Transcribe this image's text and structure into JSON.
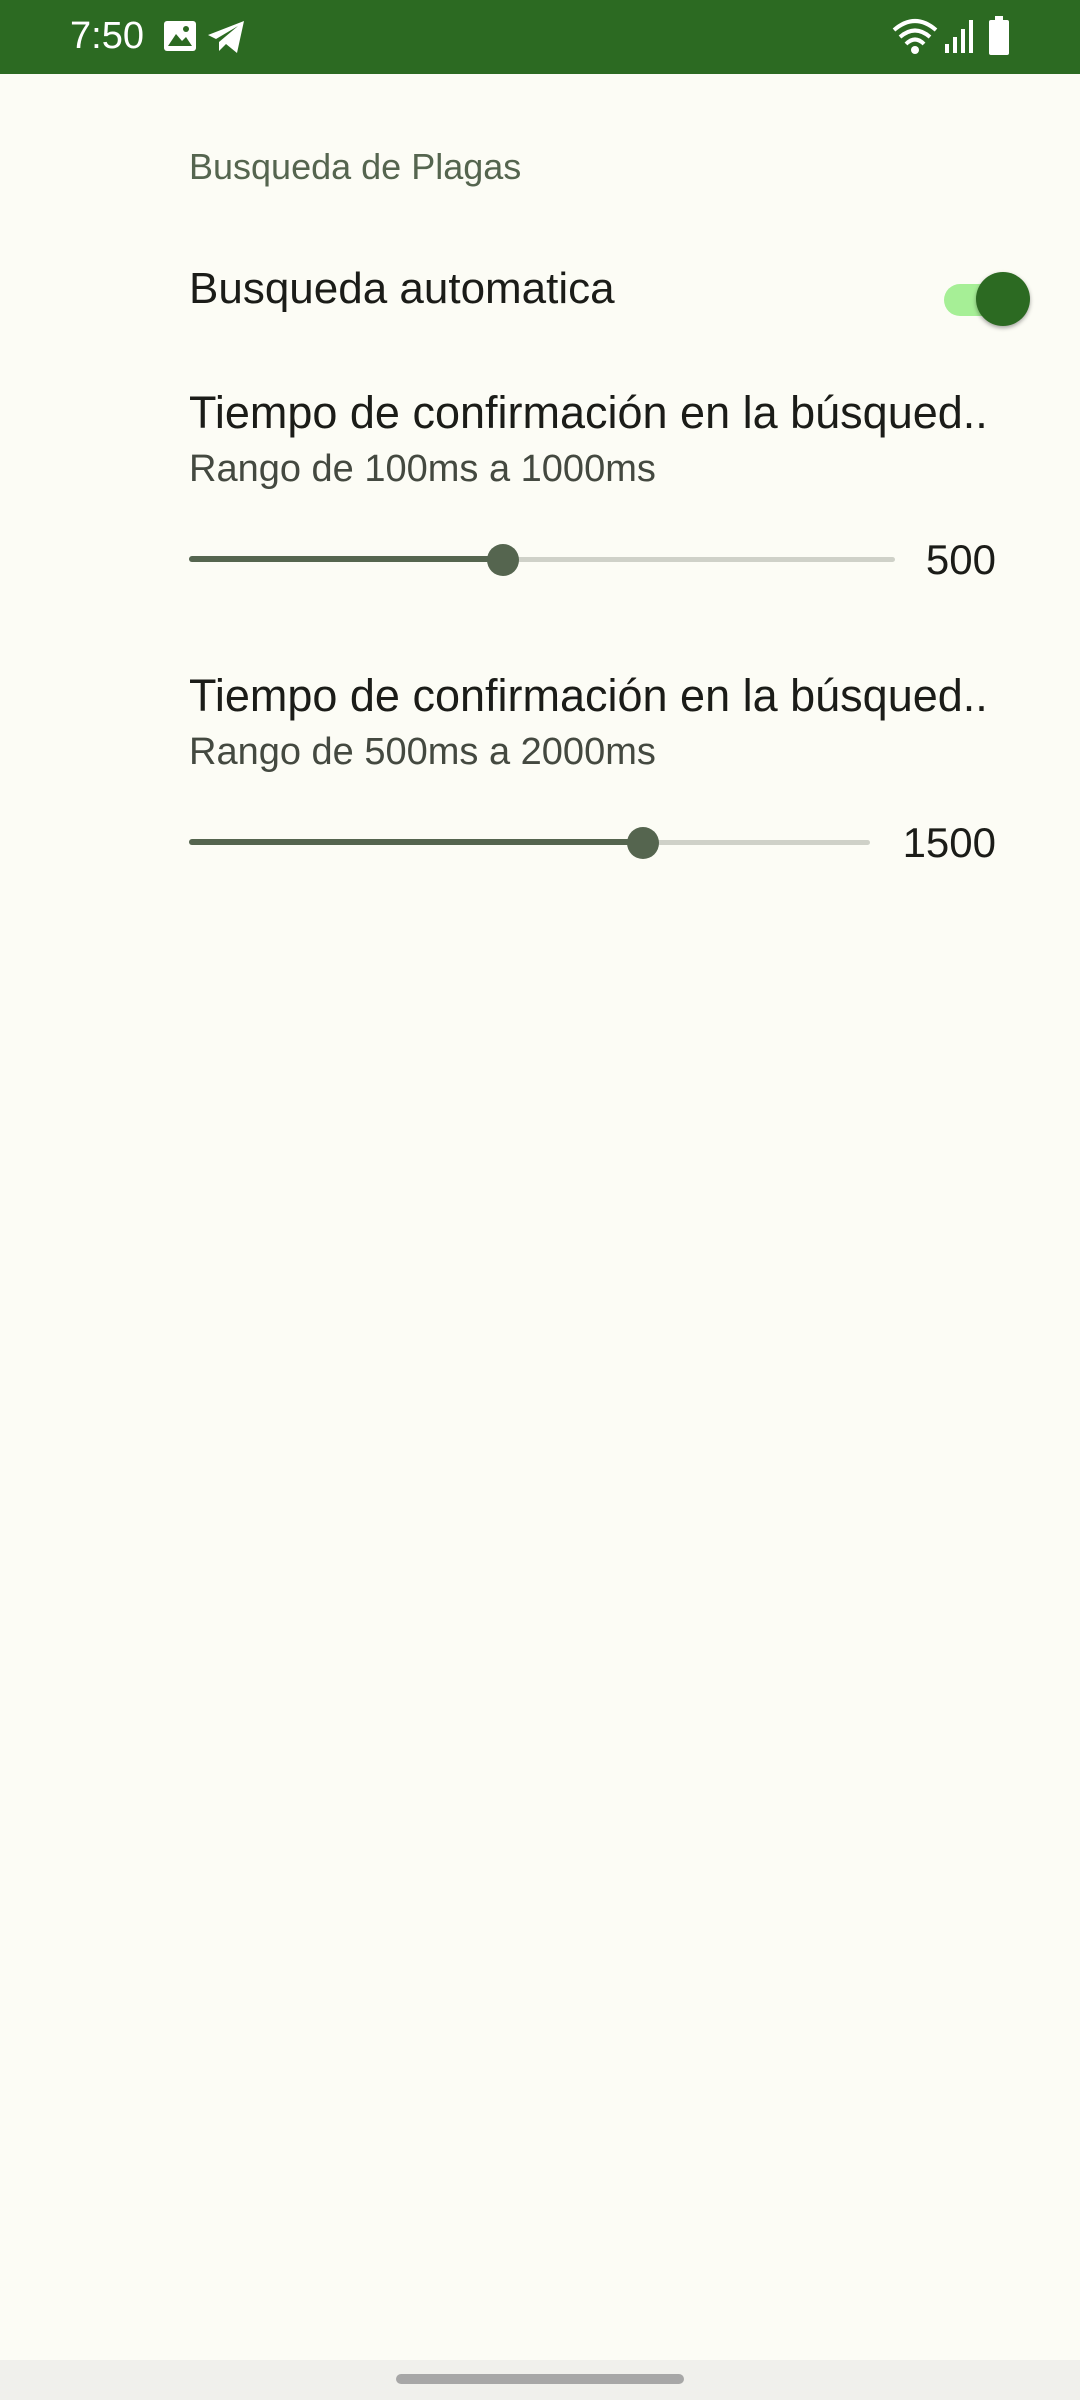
{
  "status_bar": {
    "time": "7:50",
    "left_icons": [
      "image-icon",
      "telegram-icon"
    ],
    "right_icons": [
      "wifi-icon",
      "signal-icon",
      "battery-icon"
    ],
    "color": "#2c6a22"
  },
  "section": {
    "title": "Busqueda de Plagas"
  },
  "auto_search": {
    "label": "Busqueda automatica",
    "enabled": true
  },
  "preferences": [
    {
      "title": "Tiempo de confirmación en la búsqued..",
      "summary": "Rango de 100ms a 1000ms",
      "min": 100,
      "max": 1000,
      "value": 500,
      "value_label": "500"
    },
    {
      "title": "Tiempo de confirmación en la búsqued..",
      "summary": "Rango de 500ms a 2000ms",
      "min": 500,
      "max": 2000,
      "value": 1500,
      "value_label": "1500"
    }
  ],
  "colors": {
    "accent": "#2c6a22",
    "slider": "#55654f",
    "switch_track": "#a6ef96",
    "background": "#fcfcf5"
  }
}
